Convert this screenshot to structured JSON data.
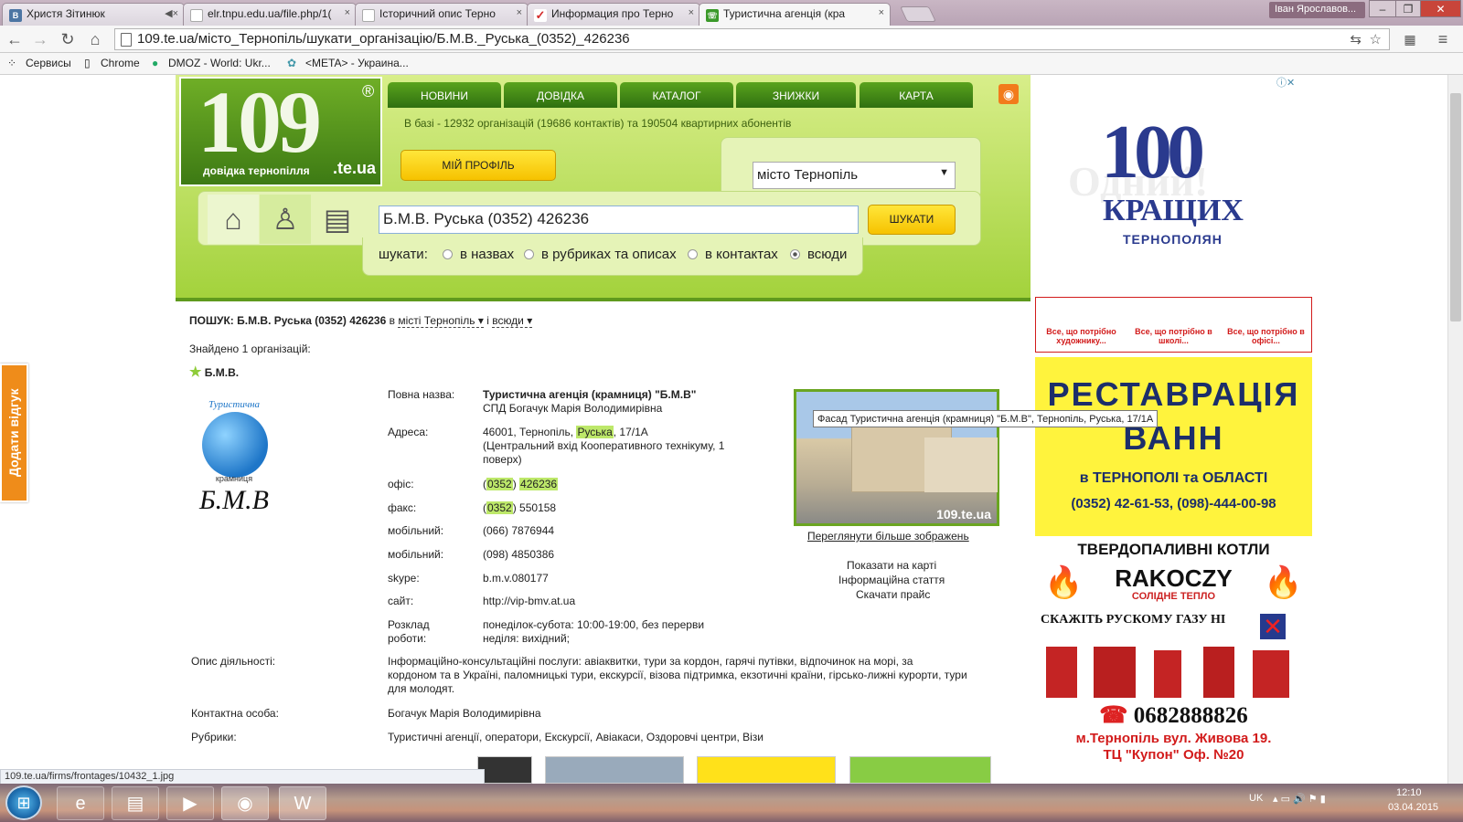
{
  "browser": {
    "tabs": [
      {
        "label": "Христя Зітинюк",
        "fav": "В",
        "fav_color": "#4c75a3"
      },
      {
        "label": "elr.tnpu.edu.ua/file.php/1(",
        "fav": "",
        "fav_color": "#ffffff"
      },
      {
        "label": "Історичний опис Терно",
        "fav": "",
        "fav_color": "#ffffff"
      },
      {
        "label": "Информация про Терно",
        "fav": "✓",
        "fav_color": "#d42a2a"
      },
      {
        "label": "Туристична агенція (кра",
        "fav": "☏",
        "fav_color": "#3b9a2a"
      }
    ],
    "user": "Іван Ярославов...",
    "url": "109.te.ua/місто_Тернопіль/шукати_організацію/Б.М.В._Руська_(0352)_426236",
    "bookmarks": [
      "Сервисы",
      "Chrome",
      "DMOZ - World: Ukr...",
      "<META> - Украина..."
    ],
    "status_url": "109.te.ua/firms/frontages/10432_1.jpg"
  },
  "site": {
    "logo": {
      "number": "109",
      "reg": "®",
      "subtitle": "довідка тернопілля",
      "domain": ".te.ua"
    },
    "nav": [
      "НОВИНИ",
      "ДОВІДКА",
      "КАТАЛОГ",
      "ЗНИЖКИ",
      "КАРТА"
    ],
    "db_info": "В базі - 12932 організацій (19686 контактів) та 190504 квартирних абонентів",
    "profile_button": "МІЙ ПРОФІЛЬ",
    "city": "місто Тернопіль",
    "search_value": "Б.М.В. Руська (0352) 426236",
    "search_button": "ШУКАТИ",
    "search_label": "шукати:",
    "search_options": [
      "в назвах",
      "в рубриках та описах",
      "в контактах",
      "всюди"
    ],
    "search_selected": "всюди"
  },
  "result": {
    "query_prefix": "ПОШУК: Б.М.В. Руська (0352) 426236",
    "query_in": "в",
    "city_link": "місті Тернопіль ▾",
    "and": "і",
    "scope_link": "всюди ▾",
    "found": "Знайдено 1 організацій:",
    "org_name": "Б.М.В.",
    "full_name_label": "Повна назва:",
    "full_name": "Туристична агенція (крамниця) \"Б.М.В\"",
    "owner": "СПД Богачук Марія Володимирівна",
    "address_label": "Адреса:",
    "address_pre": "46001, Тернопіль,",
    "address_hl": "Руська",
    "address_post": ", 17/1А",
    "address_note1": "(Центральний вхід Кооперативного технікуму, 1",
    "address_note2": "поверх)",
    "office_label": "офіс:",
    "office_code": "0352",
    "office_num": "426236",
    "fax_label": "факс:",
    "fax_code": "0352",
    "fax_num": "550158",
    "mobile_label": "мобільний:",
    "mobile1": "(066) 7876944",
    "mobile2": "(098) 4850386",
    "skype_label": "skype:",
    "skype": "b.m.v.080177",
    "site_label": "сайт:",
    "site": "http://vip-bmv.at.ua",
    "hours_label1": "Розклад",
    "hours_label2": "роботи:",
    "hours1": "понеділок-субота: 10:00-19:00, без перерви",
    "hours2": "неділя: вихідний;",
    "desc_label": "Опис діяльності:",
    "desc1": "Інформаційно-консультаційні  послуги: авіаквитки, тури за кордон, гарячі путівки, відпочинок на морі, за",
    "desc2": "кордоном та в Україні, паломницькі тури, екскурсії, візова підтримка, екзотичні країни, гірсько-лижні курорти, тури",
    "desc3": "для молодят.",
    "contact_label": "Контактна особа:",
    "contact": "Богачук Марія Володимирівна",
    "rubrics_label": "Рубрики:",
    "rubrics": "Туристичні агенції, оператори, Екскурсії, Авіакаси, Оздоровчі центри, Візи",
    "photo_tooltip": "Фасад Туристична агенція (крамниця) \"Б.М.В\", Тернопіль, Руська, 17/1А",
    "photo_watermark": "109.te.ua",
    "more_images": "Переглянути більше зображень",
    "show_map": "Показати на карті",
    "info_article": "Інформаційна стаття",
    "download_price": "Скачати прайс",
    "bmv_logo_top": "Туристична",
    "bmv_logo_mid": "крамниця",
    "bmv_logo_big": "Б.М.В"
  },
  "ads": {
    "a100_number": "100",
    "a100_big": "КРАЩИХ",
    "a100_small": "ТЕРНОПОЛЯН",
    "a100_bg": "Одний!",
    "row": [
      "Все, що потрібно художнику...",
      "Все, що потрібно в школі...",
      "Все, що потрібно в офісі..."
    ],
    "rest_title1": "РЕСТАВРАЦІЯ",
    "rest_title2": "ВАНН",
    "rest_sub": "в ТЕРНОПОЛІ та ОБЛАСТІ",
    "rest_phone": "(0352) 42-61-53, (098)-444-00-98",
    "boil_title": "ТВЕРДОПАЛИВНІ КОТЛИ",
    "boil_brand": "RAKOCZY",
    "boil_brand_sub": "СОЛІДНЕ ТЕПЛО",
    "boil_slogan": "СКАЖІТЬ РУСКОМУ ГАЗУ НІ",
    "boil_phone": "0682888826",
    "boil_addr1": "м.Тернопіль вул. Живова 19.",
    "boil_addr2": "ТЦ \"Купон\" Оф. №20"
  },
  "feedback": "Додати відгук",
  "taskbar": {
    "lang": "UK",
    "time": "12:10",
    "date": "03.04.2015"
  },
  "colors": {
    "accent_green": "#5f9a1d",
    "yellow": "#f6c200",
    "highlight": "#bde86a"
  }
}
